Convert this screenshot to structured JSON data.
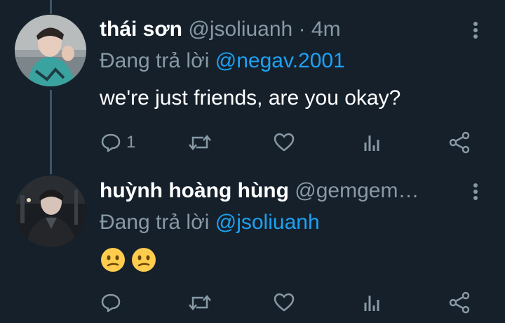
{
  "tweets": [
    {
      "name": "thái sơn",
      "handle": "@jsoliuanh",
      "time_sep": " · 4m",
      "reply_prefix": "Đang trả lời ",
      "reply_mention": "@negav.2001",
      "text": "we're just friends, are you okay?",
      "reply_count": "1"
    },
    {
      "name": "huỳnh hoàng hùng",
      "handle": "@gemgem…",
      "reply_prefix": "Đang trả lời ",
      "reply_mention": "@jsoliuanh",
      "emoji": [
        "confused-face",
        "confused-face"
      ]
    }
  ],
  "icons": {
    "reply": "reply-icon",
    "retweet": "retweet-icon",
    "like": "heart-icon",
    "analytics": "analytics-icon",
    "share": "share-icon",
    "more": "more-vertical-icon"
  },
  "colors": {
    "background": "#15202b",
    "text": "#ffffff",
    "secondary": "#8899a6",
    "mention": "#1da1f2",
    "thread_line": "#3d5466"
  }
}
